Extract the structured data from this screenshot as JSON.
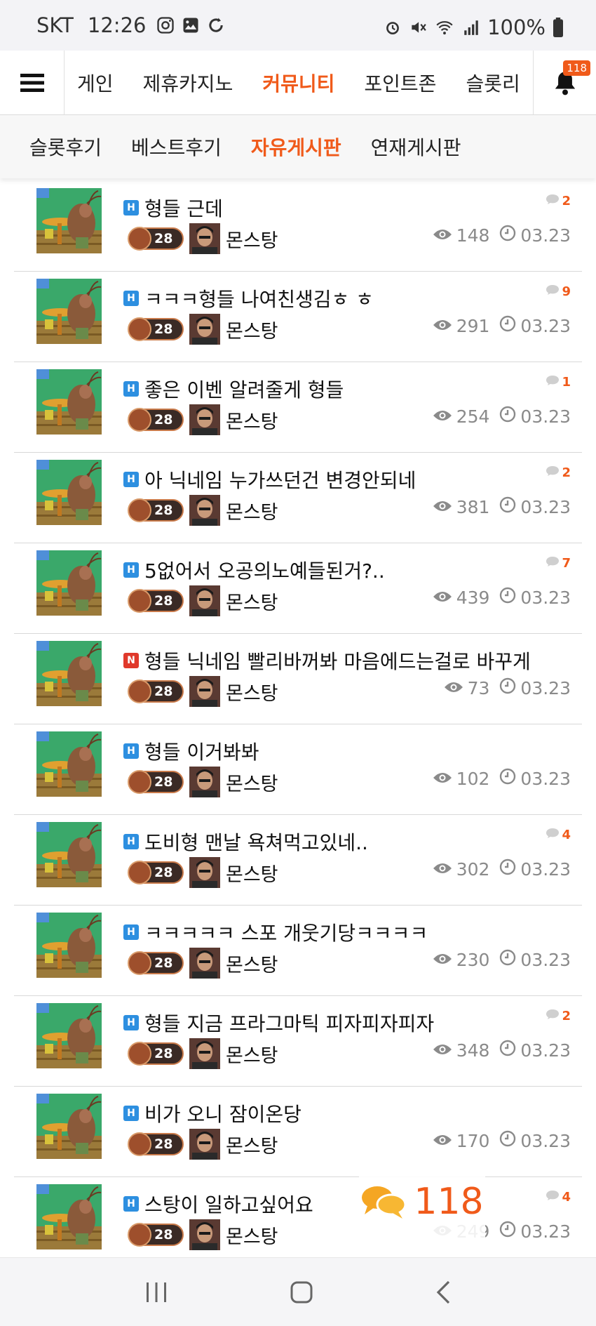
{
  "status_bar": {
    "carrier": "SKT",
    "time": "12:26",
    "battery": "100%"
  },
  "topnav": {
    "items": [
      "게인",
      "제휴카지노",
      "커뮤니티",
      "포인트존",
      "슬롯리"
    ],
    "active_index": 2,
    "notification_count": "118"
  },
  "subnav": {
    "items": [
      "슬롯후기",
      "베스트후기",
      "자유게시판",
      "연재게시판"
    ],
    "active_index": 2
  },
  "colors": {
    "accent": "#f05a1a",
    "tag_h": "#2d8fe0",
    "tag_n": "#e0392b"
  },
  "posts": [
    {
      "tag": "H",
      "title": "형들 근데",
      "comments": "2",
      "level": "28",
      "nickname": "몬스탕",
      "views": "148",
      "date": "03.23"
    },
    {
      "tag": "H",
      "title": "ㅋㅋㅋ형들 나여친생김ㅎ ㅎ",
      "comments": "9",
      "level": "28",
      "nickname": "몬스탕",
      "views": "291",
      "date": "03.23"
    },
    {
      "tag": "H",
      "title": "좋은 이벤 알려줄게 형들",
      "comments": "1",
      "level": "28",
      "nickname": "몬스탕",
      "views": "254",
      "date": "03.23"
    },
    {
      "tag": "H",
      "title": "아 닉네임 누가쓰던건 변경안되네",
      "comments": "2",
      "level": "28",
      "nickname": "몬스탕",
      "views": "381",
      "date": "03.23"
    },
    {
      "tag": "H",
      "title": "5없어서 오공의노예들된거?..",
      "comments": "7",
      "level": "28",
      "nickname": "몬스탕",
      "views": "439",
      "date": "03.23"
    },
    {
      "tag": "N",
      "title": "형들 닉네임 빨리바꺼봐 마음에드는걸로 바꾸게",
      "comments": "",
      "level": "28",
      "nickname": "몬스탕",
      "views": "73",
      "date": "03.23"
    },
    {
      "tag": "H",
      "title": "형들 이거봐봐",
      "comments": "",
      "level": "28",
      "nickname": "몬스탕",
      "views": "102",
      "date": "03.23"
    },
    {
      "tag": "H",
      "title": "도비형 맨날 욕쳐먹고있네..",
      "comments": "4",
      "level": "28",
      "nickname": "몬스탕",
      "views": "302",
      "date": "03.23"
    },
    {
      "tag": "H",
      "title": "ㅋㅋㅋㅋㅋ 스포 개웃기당ㅋㅋㅋㅋ",
      "comments": "",
      "level": "28",
      "nickname": "몬스탕",
      "views": "230",
      "date": "03.23"
    },
    {
      "tag": "H",
      "title": "형들 지금 프라그마틱 피자피자피자",
      "comments": "2",
      "level": "28",
      "nickname": "몬스탕",
      "views": "348",
      "date": "03.23"
    },
    {
      "tag": "H",
      "title": "비가 오니 잠이온당",
      "comments": "",
      "level": "28",
      "nickname": "몬스탕",
      "views": "170",
      "date": "03.23"
    },
    {
      "tag": "H",
      "title": "스탕이 일하고싶어요",
      "comments": "4",
      "level": "28",
      "nickname": "몬스탕",
      "views": "249",
      "date": "03.23"
    }
  ],
  "floating_chat": {
    "count": "118",
    "icon": "chat-bubbles-icon"
  }
}
